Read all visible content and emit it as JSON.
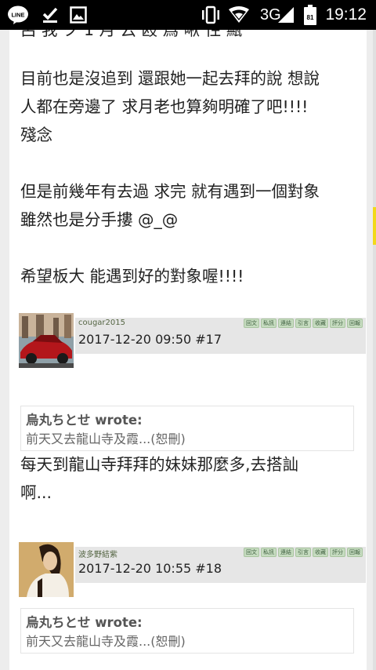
{
  "status": {
    "network": "3G",
    "battery_level": "81",
    "time": "19:12",
    "icons": [
      "line-app-icon",
      "download-done-icon",
      "gallery-icon",
      "vibrate-icon",
      "wifi-icon",
      "signal-icon",
      "battery-icon"
    ]
  },
  "partial_line": "呂 我 ク 1 月 云 殴 爲 啾 性 甒",
  "post16_text": "目前也是沒追到 還跟她一起去拜的說 想說\n人都在旁邊了 求月老也算夠明確了吧!!!!\n殘念\n\n但是前幾年有去過 求完 就有遇到一個對象\n雖然也是分手摟 @_@\n\n希望板大 能遇到好的對象喔!!!!",
  "actions": [
    "回文",
    "私訊",
    "連結",
    "引言",
    "收藏",
    "評分",
    "回報"
  ],
  "post17": {
    "username": "cougar2015",
    "meta": "2017-12-20 09:50  #17",
    "quote_author": "烏丸ちとせ wrote:",
    "quote_text": "前天又去龍山寺及霞...(恕刪)",
    "body": "每天到龍山寺拜拜的妹妹那麼多,去搭訕\n啊..."
  },
  "post18": {
    "username": "波多野結紫",
    "meta": "2017-12-20 10:55  #18",
    "quote_author": "烏丸ちとせ wrote:",
    "quote_text": "前天又去龍山寺及霞...(恕刪)"
  }
}
